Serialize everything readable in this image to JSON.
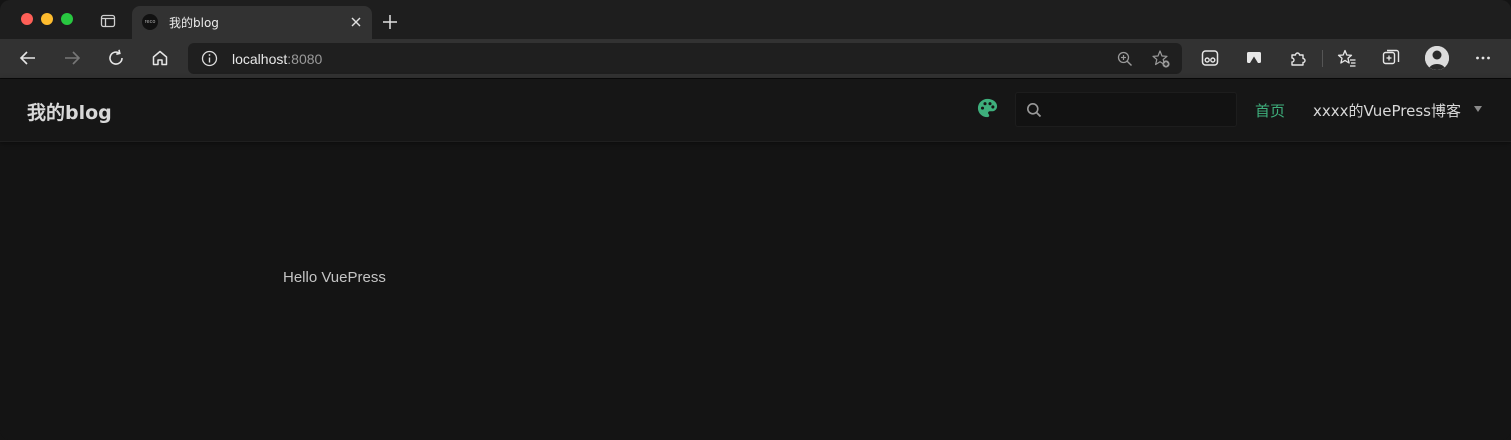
{
  "browser": {
    "tab": {
      "favicon_text": "reco",
      "title": "我的blog"
    },
    "address": {
      "host": "localhost",
      "port": ":8080"
    }
  },
  "site": {
    "title": "我的blog",
    "accent_color": "#3eaf7c",
    "search": {
      "placeholder": "",
      "value": ""
    },
    "nav": {
      "home_label": "首页",
      "dropdown_label": "xxxx的VuePress博客"
    }
  },
  "content": {
    "text": "Hello VuePress"
  },
  "icons": {
    "theme": "palette-icon",
    "search": "search-icon",
    "dropdown": "chevron-down-icon"
  }
}
